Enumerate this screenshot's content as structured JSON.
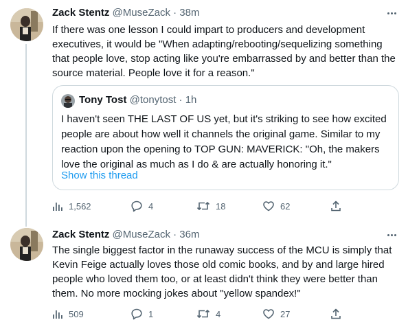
{
  "colors": {
    "text": "#0f1419",
    "secondary": "#536471",
    "border": "#cfd9de",
    "link": "#1d9bf0"
  },
  "tweets": [
    {
      "author_name": "Zack Stentz",
      "author_handle": "@MuseZack",
      "time": "· 38m",
      "text_lines": [
        "If there was one lesson I could impart to producers and development",
        "executives, it would be \"When adapting/rebooting/sequelizing something",
        "that people love, stop acting like you're embarrassed by and better than the",
        "source material. People love it for a reason.\""
      ],
      "quoted": {
        "author_name": "Tony Tost",
        "author_handle": "@tonytost",
        "time": "· 1h",
        "text_lines": [
          "I haven't seen THE LAST OF US yet, but it's striking to see how excited",
          "people are about how well it channels the original game. Similar to my",
          "reaction upon the opening to TOP GUN: MAVERICK: \"Oh, the makers",
          "love the original as much as I do & are actually honoring it.\""
        ],
        "link_label": "Show this thread"
      },
      "stats": {
        "views": "1,562",
        "replies": "4",
        "retweets": "18",
        "likes": "62"
      }
    },
    {
      "author_name": "Zack Stentz",
      "author_handle": "@MuseZack",
      "time": "· 36m",
      "text_lines": [
        "The single biggest factor in the runaway success of the MCU is simply that",
        "Kevin Feige actually loves those old comic books, and by and large hired",
        "people who loved them too, or at least didn't think they were better than",
        "them. No more mocking jokes about \"yellow spandex!\""
      ],
      "stats": {
        "views": "509",
        "replies": "1",
        "retweets": "4",
        "likes": "27"
      }
    }
  ],
  "icons": {
    "more": "more-icon",
    "views": "analytics-icon",
    "reply": "reply-icon",
    "retweet": "retweet-icon",
    "like": "heart-icon",
    "share": "share-icon"
  }
}
